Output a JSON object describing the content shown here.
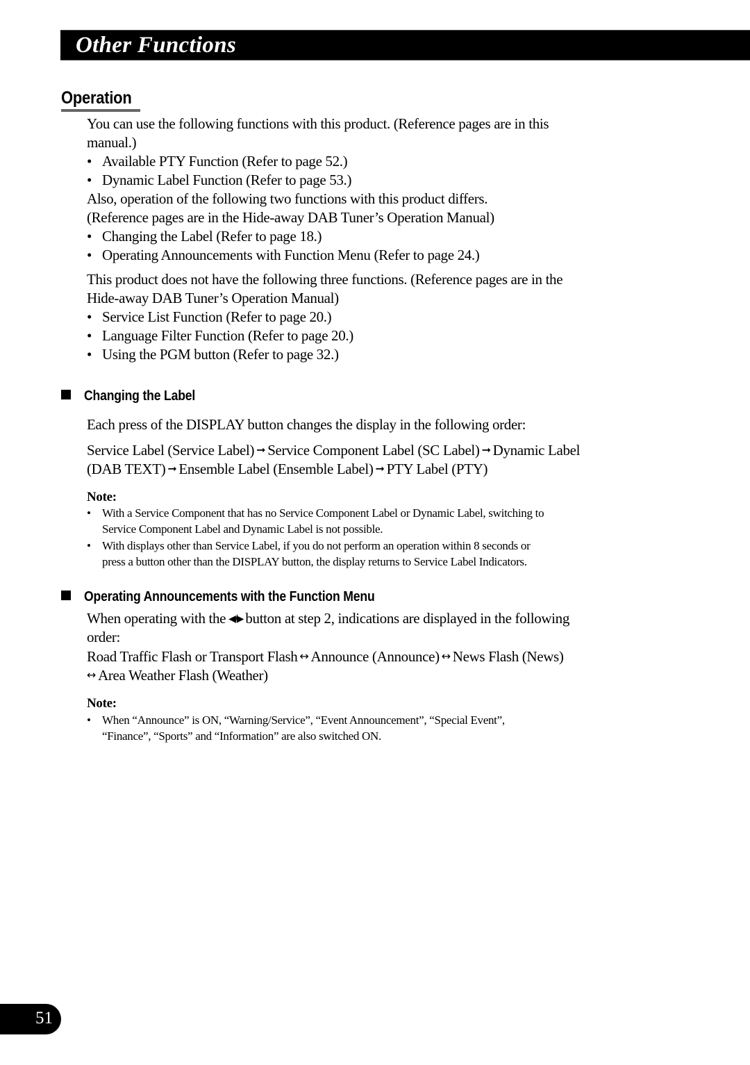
{
  "header": {
    "title": "Other Functions"
  },
  "operation": {
    "title": "Operation",
    "intro_lines": [
      "You can use the following functions with this product. (Reference pages are in this",
      "manual.)"
    ],
    "available": [
      "Available PTY Function (Refer to page 52.)",
      "Dynamic Label Function (Refer to page 53.)"
    ],
    "differs_lines": [
      "Also, operation of the following two functions with this product differs.",
      "(Reference pages are in the Hide-away DAB Tuner’s Operation Manual)"
    ],
    "differs": [
      "Changing the Label (Refer to page 18.)",
      "Operating Announcements with Function Menu (Refer to page 24.)"
    ],
    "missing_lines": [
      "This product does not have the following three functions. (Reference pages are in the",
      "Hide-away DAB Tuner’s Operation Manual)"
    ],
    "missing": [
      "Service List Function (Refer to page 20.)",
      "Language Filter Function (Refer to page 20.)",
      "Using the PGM button (Refer to page 32.)"
    ],
    "bullet": "•"
  },
  "changing_label": {
    "title": "Changing the Label",
    "intro": "Each press of the DISPLAY button changes the display in the following order:",
    "sequence": [
      "Service Label (Service Label)",
      "Service Component Label (SC Label)",
      "Dynamic Label",
      "(DAB TEXT)",
      "Ensemble Label (Ensemble Label)",
      "PTY Label (PTY)"
    ],
    "arrow_icon": "➞",
    "note_label": "Note:",
    "notes": [
      [
        "With a Service Component that has no Service Component Label or Dynamic Label, switching to",
        "Service Component Label and Dynamic Label is not possible."
      ],
      [
        "With displays other than Service Label, if you do not perform an operation within 8 seconds or",
        "press a button other than the DISPLAY button, the display returns to Service Label Indicators."
      ]
    ]
  },
  "announcements": {
    "title": "Operating Announcements with the Function Menu",
    "intro_before": "When operating with the",
    "button_icon": "◀/▶",
    "intro_after": "button at step 2, indications are displayed in the following",
    "intro_line2": "order:",
    "sequence": [
      "Road Traffic Flash or Transport Flash",
      "Announce (Announce)",
      "News Flash (News)",
      "Area Weather Flash (Weather)"
    ],
    "lr_arrow_icon": "↔",
    "note_label": "Note:",
    "notes": [
      [
        "When “Announce” is ON, “Warning/Service”, “Event Announcement”, “Special Event”,",
        "“Finance”, “Sports” and “Information” are also switched ON."
      ]
    ]
  },
  "page_number": "51"
}
